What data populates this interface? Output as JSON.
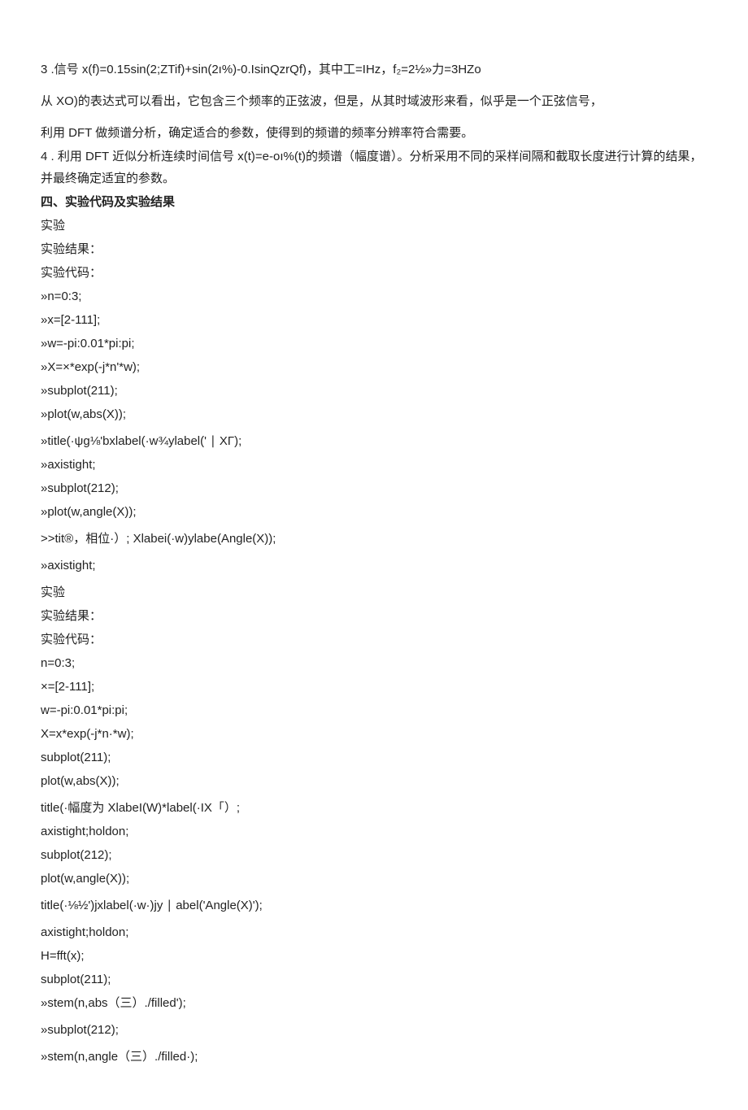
{
  "lines": [
    "3  .信号 x(f)=0.15sin(2;ZTif)+sin(2ı%)-0.IsinQzrQf)，其中工=IHz，f₂=2½»力=3HZo",
    "",
    "从 XO)的表达式可以看出，它包含三个频率的正弦波，但是，从其时域波形来看，似乎是一个正弦信号，",
    "",
    "利用 DFT 做频谱分析，确定适合的参数，使得到的频谱的频率分辨率符合需要。",
    "4  . 利用 DFT 近似分析连续时间信号 x(t)=e-oı%(t)的频谱（幅度谱）。分析采用不同的采样间隔和截取长度进行计算的结果，并最终确定适宜的参数。",
    "__BOLD__四、实验代码及实验结果",
    "实验",
    "实验结果：",
    "实验代码：",
    "»n=0:3;",
    "»x=[2-111];",
    "»w=-pi:0.01*pi:pi;",
    "»X=×*exp(-j*n'*w);",
    "»subplot(211);",
    "»plot(w,abs(X));",
    "__SP__»title(·ψg⅛'bxlabel(·w¾ylabel(' ∣ XΓ);",
    "»axistight;",
    "»subplot(212);",
    "»plot(w,angle(X));",
    "__SP__>>tit®，相位·）; Xlabei(·w)ylabe(Angle(X));",
    "__SP__»axistight;",
    "__SP__实验",
    "实验结果：",
    "实验代码：",
    "n=0:3;",
    "×=[2-111];",
    "w=-pi:0.01*pi:pi;",
    "X=x*exp(-j*n·*w);",
    "subplot(211);",
    "plot(w,abs(X));",
    "__SP__title(·幅度为 XlabeI(W)*label(·IX「）;",
    "axistight;holdon;",
    "subplot(212);",
    "plot(w,angle(X));",
    "__SP__title(·⅛½')jxlabel(·w·)jy ∣ abel('Angle(X)');",
    "__SP__axistight;holdon;",
    "H=fft(x);",
    "subplot(211);",
    "»stem(n,abs（三）./filled');",
    "__SP__»subplot(212);",
    "__SP__»stem(n,angle（三）./filled·);"
  ]
}
